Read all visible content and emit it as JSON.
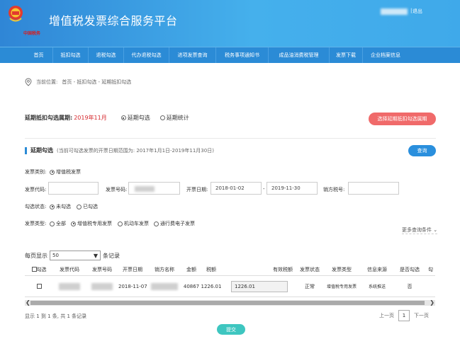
{
  "header": {
    "title": "增值税发票综合服务平台",
    "logo_text": "中国税务",
    "separator": "|",
    "logout_label": "退出"
  },
  "nav": {
    "items": [
      "首页",
      "抵扣勾选",
      "退税勾选",
      "代办退税勾选",
      "进项发票查询",
      "税务事项通知书",
      "成品油消费税管理",
      "发票下载",
      "企业档案信息"
    ]
  },
  "breadcrumb": {
    "prefix": "当前位置:",
    "path": "首页 - 抵扣勾选 - 延期抵扣勾选"
  },
  "period": {
    "label": "延期抵扣勾选属期:",
    "value": "2019年11月",
    "option_check": "延期勾选",
    "option_stats": "延期统计",
    "apply_button": "选择延期抵扣勾选属期"
  },
  "section": {
    "title": "延期勾选",
    "hint": "(当前可勾选发票的开票日期范围为: 2017年1月1日-2019年11月30日)",
    "query_button": "查询"
  },
  "filters": {
    "invoice_category_label": "发票类别:",
    "invoice_category_value": "增值税发票",
    "invoice_code_label": "发票代码:",
    "invoice_number_label": "发票号码:",
    "issue_date_label": "开票日期:",
    "date_from": "2018-01-02",
    "date_sep": "-",
    "date_to": "2019-11-30",
    "seller_tax_label": "销方税号:",
    "check_status_label": "勾选状态:",
    "status_unchecked": "未勾选",
    "status_checked": "已勾选",
    "invoice_type_label": "发票类型:",
    "type_all": "全部",
    "type_vat_special": "增值税专用发票",
    "type_vehicle": "机动车发票",
    "type_toll": "通行费电子发票",
    "more_conditions": "更多查询条件"
  },
  "paging": {
    "page_size_prefix": "每页显示",
    "page_size_value": "50",
    "page_size_suffix": "条记录",
    "summary": "显示 1 到 1 条, 共 1 条记录",
    "prev": "上一页",
    "current": "1",
    "next": "下一页"
  },
  "table": {
    "headers": [
      "勾选",
      "发票代码",
      "发票号码",
      "开票日期",
      "销方名称",
      "金额",
      "税额",
      "有效税额",
      "发票状态",
      "发票类型",
      "信息来源",
      "是否勾选",
      "勾"
    ],
    "rows": [
      {
        "issue_date": "2018-11-07",
        "amount": "40867",
        "tax": "1226.01",
        "effective_tax": "1226.01",
        "status": "正常",
        "type": "增值税专用发票",
        "source": "系统推送",
        "selected": "否"
      }
    ]
  },
  "footer": {
    "submit_label": "提交"
  },
  "colors": {
    "header_start": "#2f86d6",
    "header_end": "#45b0ec",
    "nav": "#2b8bd6",
    "period_value": "#d6292e",
    "apply_button": "#f06a6a",
    "query_button": "#2a8fdd",
    "submit_button": "#3ec6c0"
  }
}
